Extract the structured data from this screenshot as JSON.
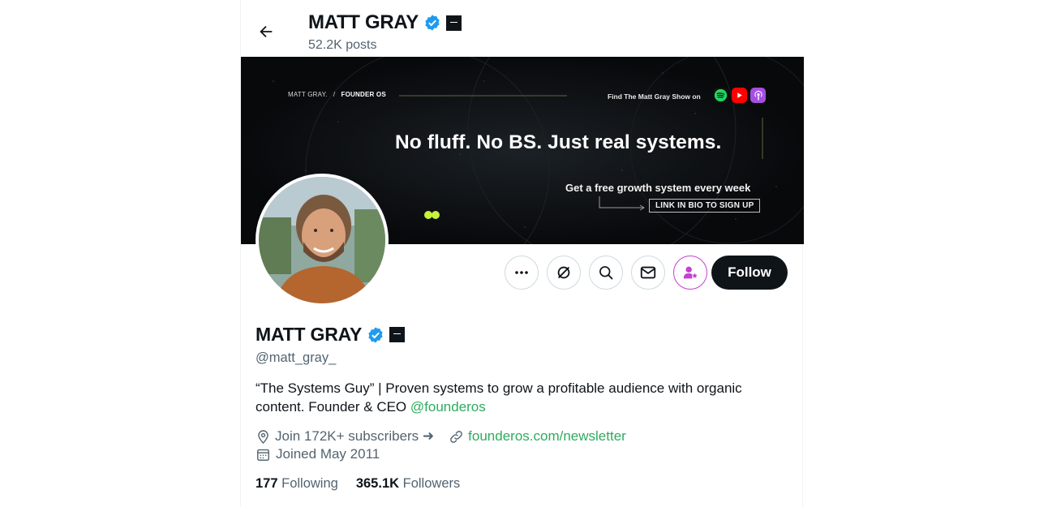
{
  "header": {
    "name": "MATT GRAY",
    "posts": "52.2K posts"
  },
  "banner": {
    "brand": "MATT GRAY.",
    "brand_sep": "/",
    "brand_product": "FOUNDER OS",
    "find_text": "Find The Matt Gray Show on",
    "headline": "No fluff. No BS. Just real systems.",
    "subline": "Get a free growth system every week",
    "cta": "LINK IN BIO TO SIGN UP"
  },
  "actions": {
    "follow_label": "Follow"
  },
  "profile": {
    "name": "MATT GRAY",
    "handle": "@matt_gray_",
    "bio_text": "“The Systems Guy” | Proven systems to grow a profitable audience with organic content. Founder & CEO ",
    "bio_mention": "@founderos",
    "location": "Join 172K+ subscribers ➜",
    "website": "founderos.com/newsletter",
    "joined": "Joined May 2011"
  },
  "stats": {
    "following_count": "177",
    "following_label": "Following",
    "followers_count": "365.1K",
    "followers_label": "Followers"
  },
  "colors": {
    "link": "#2eab5e",
    "verified": "#1d9bf0",
    "subscribe": "#c73fd2"
  }
}
